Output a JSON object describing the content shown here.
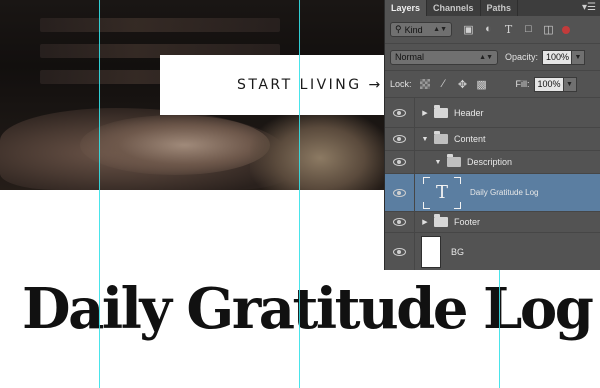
{
  "canvas": {
    "cta_label": "START LIVING →",
    "headline": "Daily Gratitude Log"
  },
  "layers_panel": {
    "tabs": [
      "Layers",
      "Channels",
      "Paths"
    ],
    "active_tab": "Layers",
    "filter": {
      "value": "Kind",
      "icons": [
        "image-filter-icon",
        "adjustment-filter-icon",
        "type-filter-icon",
        "shape-filter-icon",
        "smart-object-filter-icon"
      ]
    },
    "blend_mode": "Normal",
    "opacity_label": "Opacity:",
    "opacity_value": "100%",
    "lock_label": "Lock:",
    "fill_label": "Fill:",
    "fill_value": "100%",
    "layers": [
      {
        "name": "Header",
        "type": "group",
        "expanded": false,
        "indent": 0
      },
      {
        "name": "Content",
        "type": "group",
        "expanded": true,
        "indent": 0
      },
      {
        "name": "Description",
        "type": "group",
        "expanded": true,
        "indent": 1
      },
      {
        "name": "Daily Gratitude Log",
        "type": "text",
        "selected": true,
        "indent": 2
      },
      {
        "name": "Footer",
        "type": "group",
        "expanded": false,
        "indent": 0
      },
      {
        "name": "BG",
        "type": "image",
        "indent": 0
      }
    ]
  },
  "colors": {
    "guide": "#35e1e8",
    "panel_bg": "#535353",
    "selected_layer": "#5b7ea1",
    "filter_toggle": "#c23b3b"
  }
}
